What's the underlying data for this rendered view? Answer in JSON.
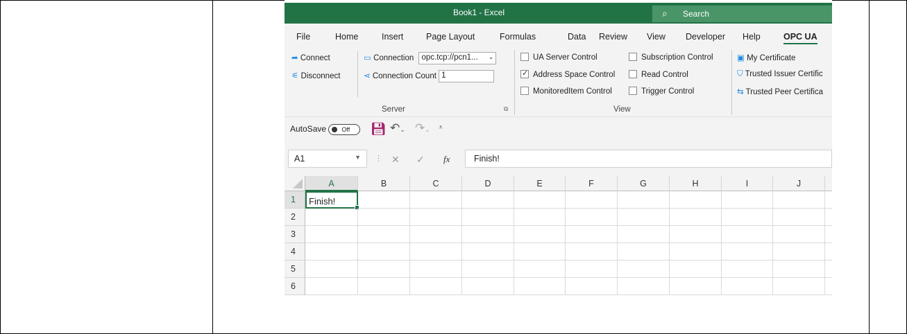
{
  "window": {
    "title": "Book1  -  Excel"
  },
  "search": {
    "label": "Search"
  },
  "tabs": [
    "File",
    "Home",
    "Insert",
    "Page Layout",
    "Formulas",
    "Data",
    "Review",
    "View",
    "Developer",
    "Help",
    "OPC UA"
  ],
  "active_tab": "OPC UA",
  "ribbon": {
    "connect": "Connect",
    "disconnect": "Disconnect",
    "connection_label": "Connection",
    "connection_value": "opc.tcp://pcn1...",
    "connection_count_label": "Connection Count",
    "connection_count_value": "1",
    "server_group": "Server",
    "view_group": "View",
    "checkboxes": [
      {
        "label": "UA Server Control",
        "checked": false
      },
      {
        "label": "Address Space Control",
        "checked": true
      },
      {
        "label": "MonitoredItem Control",
        "checked": false
      },
      {
        "label": "Subscription Control",
        "checked": false
      },
      {
        "label": "Read Control",
        "checked": false
      },
      {
        "label": "Trigger Control",
        "checked": false
      }
    ],
    "my_certificate": "My Certificate",
    "trusted_issuer": "Trusted Issuer Certific",
    "trusted_peer": "Trusted Peer Certifica"
  },
  "qat": {
    "autosave_label": "AutoSave",
    "autosave_state": "Off"
  },
  "formula_bar": {
    "name_box": "A1",
    "fx": "fx",
    "content": "Finish!"
  },
  "grid": {
    "columns": [
      "A",
      "B",
      "C",
      "D",
      "E",
      "F",
      "G",
      "H",
      "I",
      "J"
    ],
    "rows": [
      "1",
      "2",
      "3",
      "4",
      "5",
      "6"
    ],
    "cells": {
      "A1": "Finish!"
    }
  },
  "colors": {
    "excel_green": "#217346",
    "accent_blue": "#1e88e5"
  }
}
